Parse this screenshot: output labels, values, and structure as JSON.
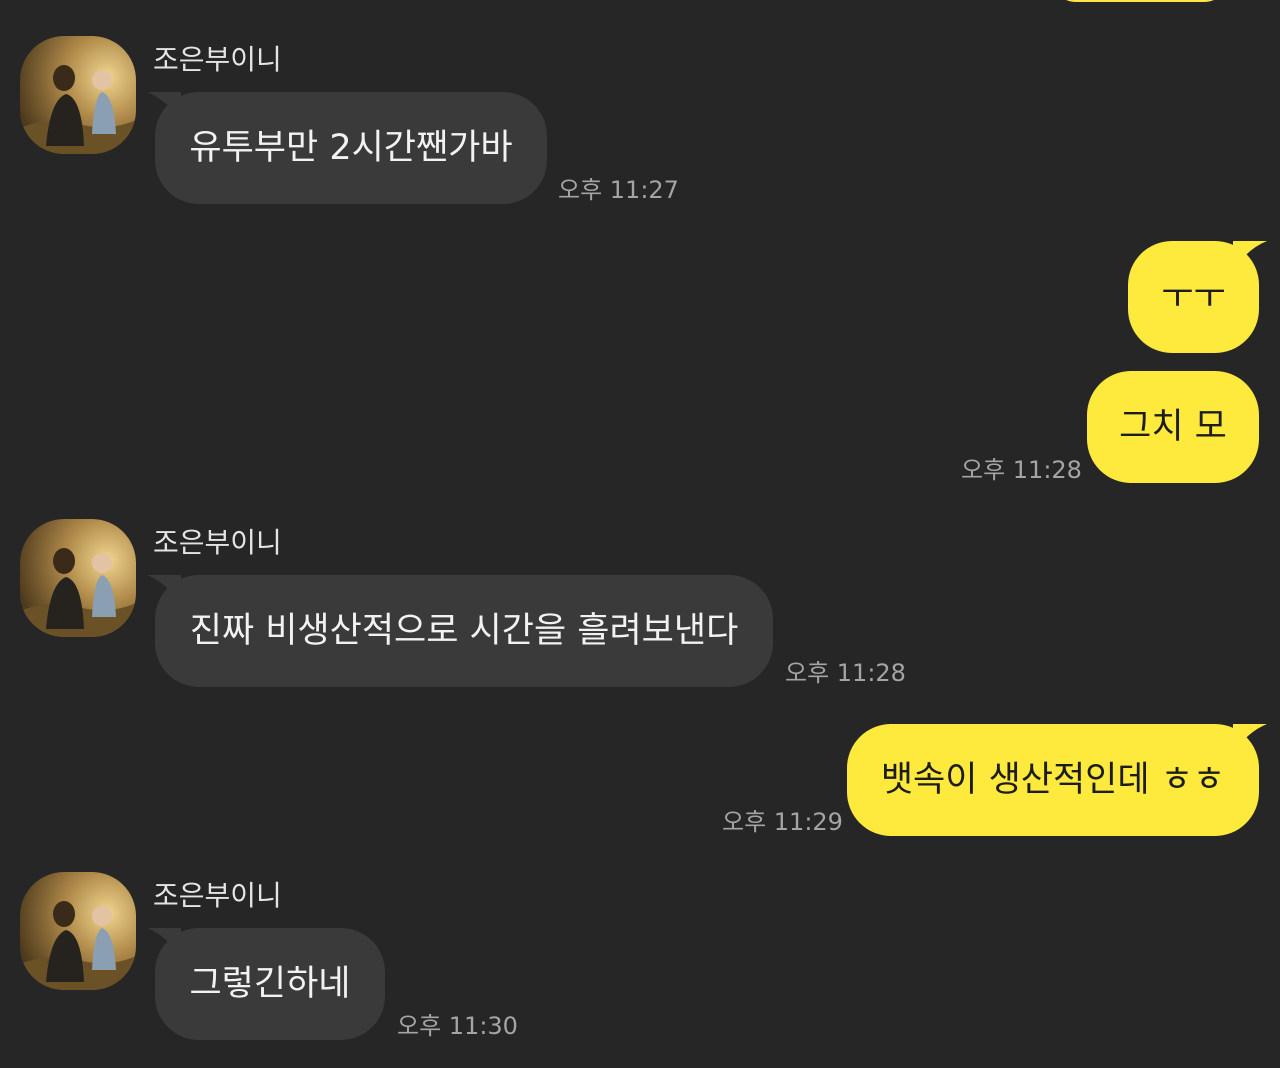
{
  "colors": {
    "background": "#262626",
    "incoming_bubble": "#3a3a3a",
    "outgoing_bubble": "#fee93d",
    "timestamp": "#a4a4a4",
    "sender_name": "#e4e4e4"
  },
  "messages": [
    {
      "sender": "조은부이니",
      "text": "유투부만 2시간짼가바",
      "time": "오후 11:27"
    },
    {
      "text": "ㅜㅜ"
    },
    {
      "text": "그치 모",
      "time": "오후 11:28"
    },
    {
      "sender": "조은부이니",
      "text": "진짜 비생산적으로 시간을 흘려보낸다",
      "time": "오후 11:28"
    },
    {
      "text": "뱃속이 생산적인데 ㅎㅎ",
      "time": "오후 11:29"
    },
    {
      "sender": "조은부이니",
      "text": "그렇긴하네",
      "time": "오후 11:30"
    }
  ]
}
